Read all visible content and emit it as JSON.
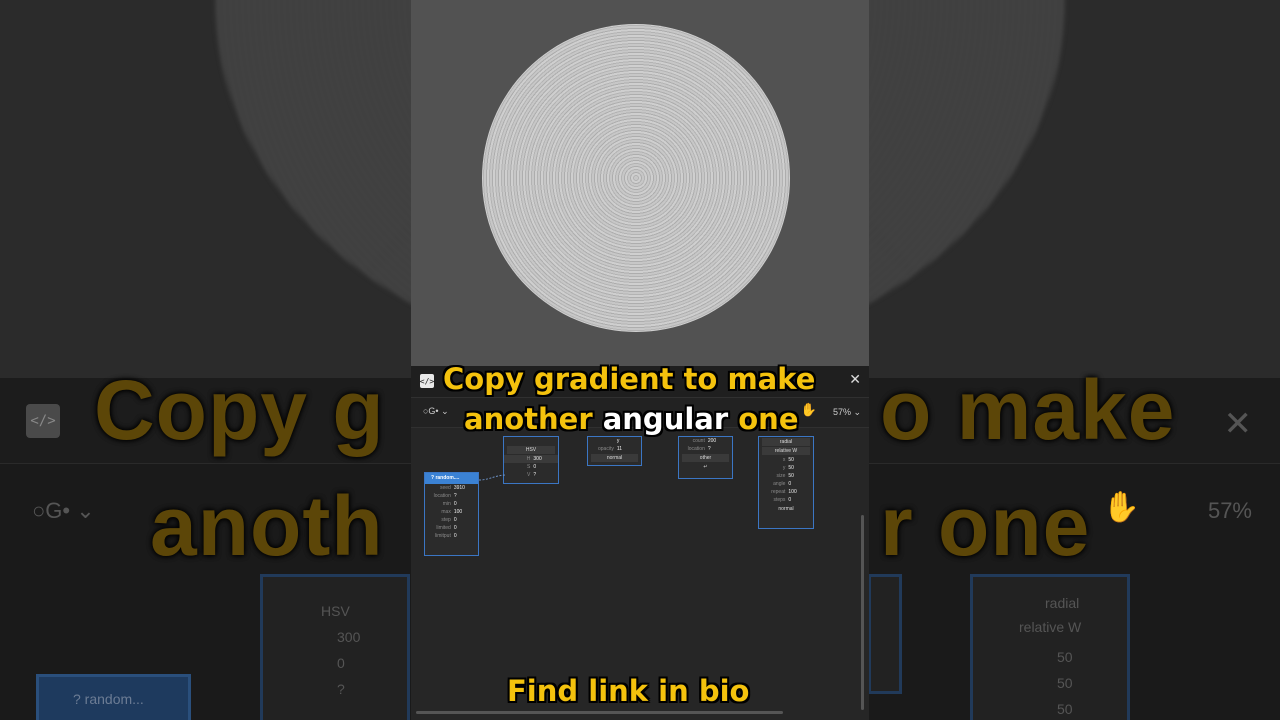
{
  "captions": {
    "line1": "Copy gradient to make",
    "line2_a": "another ",
    "line2_b": "angular",
    "line2_c": " one",
    "footer": "Find link  in bio"
  },
  "background_captions": {
    "line1_left": "Copy g",
    "line1_right": "o make",
    "line2_left": "anoth",
    "line2_right": "r one"
  },
  "toolbar": {
    "graph_select": "○G• ⌄",
    "zoom": "57% ⌄"
  },
  "nodes": {
    "random": {
      "title": "? random....",
      "rows": [
        {
          "k": "seed",
          "v": "3910"
        },
        {
          "k": "location",
          "v": "?"
        },
        {
          "k": "min",
          "v": "0"
        },
        {
          "k": "max",
          "v": "100"
        },
        {
          "k": "step",
          "v": "0"
        },
        {
          "k": "limited",
          "v": "0"
        },
        {
          "k": "limitput",
          "v": "0"
        }
      ]
    },
    "hsv": {
      "mode": "HSV",
      "rows": [
        {
          "k": "H",
          "v": "300"
        },
        {
          "k": "S",
          "v": "0"
        },
        {
          "k": "V",
          "v": "?"
        }
      ]
    },
    "blend": {
      "rows": [
        {
          "k": "",
          "v": "y"
        },
        {
          "k": "opacity",
          "v": "11"
        }
      ],
      "mode": "normal"
    },
    "repeat": {
      "rows": [
        {
          "k": "count",
          "v": "200"
        },
        {
          "k": "location",
          "v": "?"
        }
      ],
      "button": "other",
      "arrow": "↵"
    },
    "gradient": {
      "type": "radial",
      "size": "relative W",
      "rows": [
        {
          "k": "x",
          "v": "50"
        },
        {
          "k": "y",
          "v": "50"
        },
        {
          "k": "size",
          "v": "50"
        },
        {
          "k": "angle",
          "v": "0"
        },
        {
          "k": "repeat",
          "v": "100"
        },
        {
          "k": "steps",
          "v": "0"
        }
      ],
      "mode": "normal"
    }
  },
  "background": {
    "hsv_mode": "HSV",
    "hsv_h": "300",
    "hsv_s": "0",
    "hsv_v": "?",
    "random_title": "? random...",
    "gradient_type": "radial",
    "gradient_size": "relative W",
    "values": [
      "50",
      "50",
      "50"
    ],
    "zoom": "57%",
    "graph_select": "○G• ⌄"
  }
}
